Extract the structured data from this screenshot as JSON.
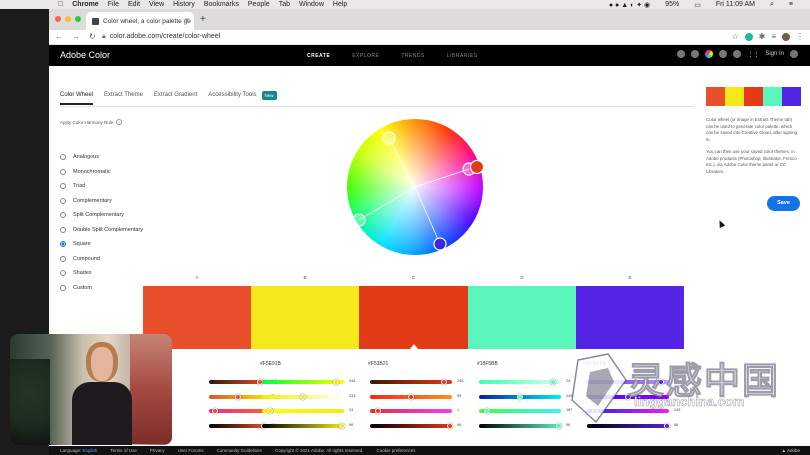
{
  "menubar": {
    "items": [
      "Chrome",
      "File",
      "Edit",
      "View",
      "History",
      "Bookmarks",
      "People",
      "Tab",
      "Window",
      "Help"
    ],
    "battery": "95%",
    "clock": "Fri 11:09 AM"
  },
  "browser": {
    "tab_title": "Color wheel, a color palette ge",
    "url": "color.adobe.com/create/color-wheel"
  },
  "app": {
    "brand": "Adobe Color",
    "nav": [
      "CREATE",
      "EXPLORE",
      "TRENDS",
      "LIBRARIES"
    ],
    "sign_in": "Sign In"
  },
  "subtabs": {
    "items": [
      "Color Wheel",
      "Extract Theme",
      "Extract Gradient",
      "Accessibility Tools"
    ],
    "badge": "New"
  },
  "harmony": {
    "label": "Apply Color Harmony Rule",
    "options": [
      "Analogous",
      "Monochromatic",
      "Triad",
      "Complementary",
      "Split Complementary",
      "Double Split Complementary",
      "Square",
      "Compound",
      "Shades",
      "Custom"
    ],
    "selected": "Square"
  },
  "swatches": {
    "letters": [
      "A",
      "B",
      "C",
      "D",
      "E"
    ],
    "colors": [
      "#E8502B",
      "#F5E91B",
      "#E33B17",
      "#5AF5BB",
      "#5525E6"
    ],
    "hex_labels": [
      "",
      "#F5E91B",
      "#F53B21",
      "#18F5BB",
      "#5D6FFB"
    ],
    "selected_index": 2
  },
  "sliders": {
    "values": [
      [
        "245",
        "76",
        "24",
        "96"
      ],
      [
        "245",
        "233",
        "24",
        "96"
      ],
      [
        "245",
        "59",
        "1",
        "96"
      ],
      [
        "24",
        "245",
        "187",
        "96"
      ],
      [
        "24",
        "",
        "245",
        "96"
      ]
    ]
  },
  "sidepanel": {
    "text1": "Color wheel (or image in Extract Theme tab) can be used to generate color palette, which can be saved into Creative Cloud, after signing in.",
    "text2": "You can then use your saved color themes, in Adobe products (Photoshop, Illustrator, Fresco etc.), via Adobe Color theme panel or CC Libraries.",
    "save_label": "Save"
  },
  "footer": {
    "language_label": "Language:",
    "language": "English",
    "links": [
      "Terms of Use",
      "Privacy",
      "User Forums",
      "Community Guidelines",
      "Copyright © 2021 Adobe. All rights reserved.",
      "Cookie preferences"
    ],
    "brand": "Adobe"
  },
  "watermark": {
    "text": "灵感中国",
    "url": "lingganchina.com"
  }
}
